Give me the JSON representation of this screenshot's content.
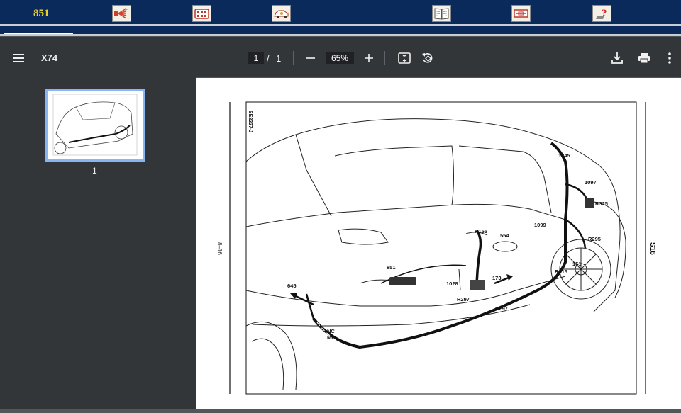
{
  "app_bar": {
    "code": "851",
    "icons": [
      "wiring-network-icon",
      "connector-icon",
      "car-location-icon",
      "manual-book-icon",
      "fuse-panel-icon",
      "help-icon"
    ]
  },
  "toolbar": {
    "title": "X74",
    "current_page": "1",
    "page_separator": "/",
    "total_pages": "1",
    "zoom": "65%"
  },
  "sidebar": {
    "thumbnail_label": "1"
  },
  "document": {
    "figure_ref": "SE2227-J",
    "page_ref": "8–16",
    "section_tag": "S16",
    "callouts": [
      "1245",
      "1097",
      "R325",
      "R295",
      "151",
      "R315",
      "1099",
      "554",
      "R155",
      "851",
      "1028",
      "R297",
      "R297",
      "173",
      "645",
      "NC",
      "MB"
    ]
  },
  "colors": {
    "app_bar_bg": "#0b2a5c",
    "code_text": "#e8d22c",
    "toolbar_bg": "#323639",
    "viewer_bg": "#525659",
    "thumbnail_border": "#8ab4f8"
  }
}
